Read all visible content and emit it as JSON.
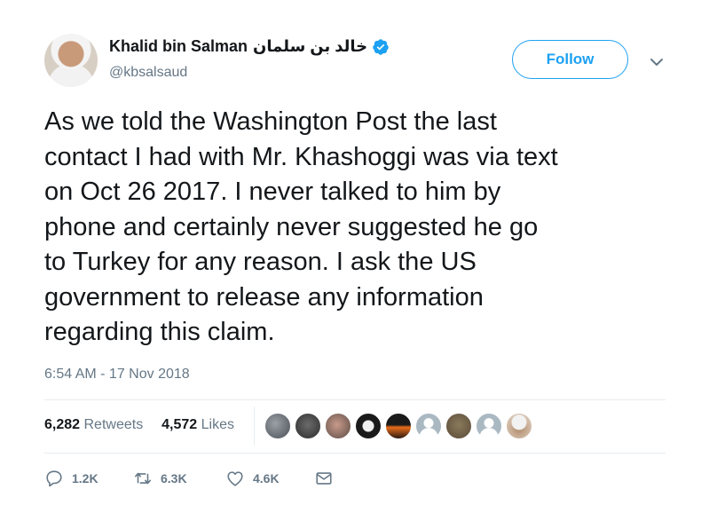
{
  "author": {
    "display_name": "Khalid bin Salman",
    "arabic_name": "خالد بن سلمان",
    "handle": "@kbsalsaud"
  },
  "header": {
    "follow_label": "Follow"
  },
  "tweet": {
    "lines": [
      "As we told the Washington Post the last",
      "contact I had with Mr. Khashoggi was via text",
      "on Oct 26 2017. I never talked to him by",
      "phone and certainly never suggested he go",
      "to Turkey for any reason. I ask the US",
      "government to release any information",
      "regarding this claim."
    ],
    "timestamp": "6:54 AM - 17 Nov 2018"
  },
  "stats": {
    "retweets_count": "6,282",
    "retweets_label": "Retweets",
    "likes_count": "4,572",
    "likes_label": "Likes"
  },
  "actions": {
    "reply_count": "1.2K",
    "retweet_count": "6.3K",
    "like_count": "4.6K"
  },
  "colors": {
    "accent": "#1da1f2",
    "secondary_text": "#657786",
    "primary_text": "#14171a"
  },
  "icons": [
    "verified-badge-icon",
    "chevron-down-icon",
    "reply-icon",
    "retweet-icon",
    "heart-icon",
    "direct-message-icon"
  ]
}
